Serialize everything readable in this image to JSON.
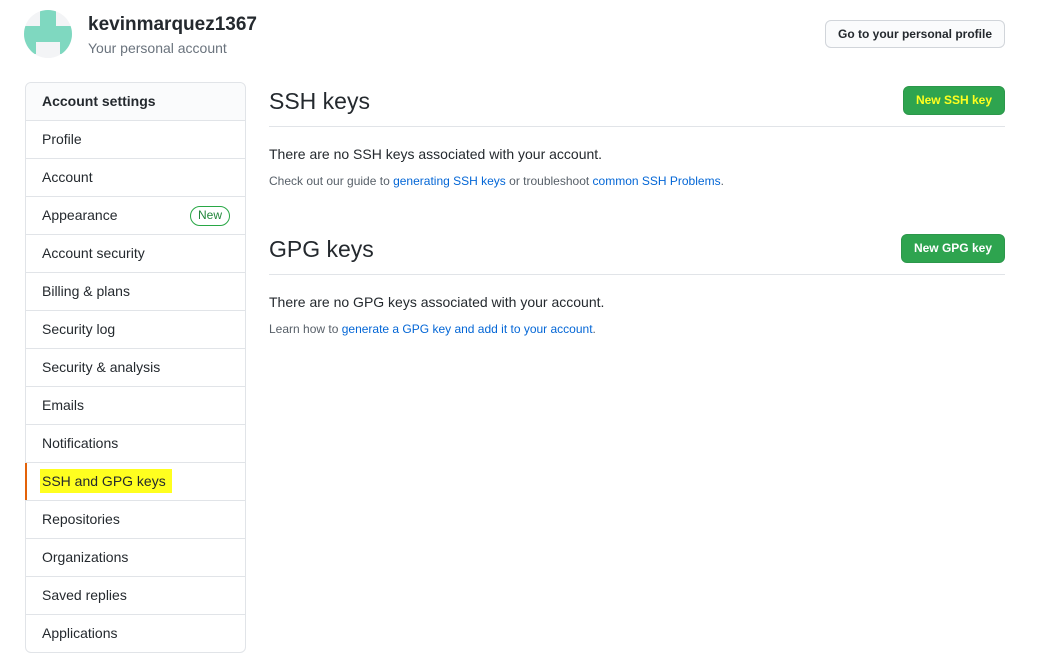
{
  "header": {
    "username": "kevinmarquez1367",
    "subtitle": "Your personal account",
    "profile_button": "Go to your personal profile"
  },
  "sidebar": {
    "heading": "Account settings",
    "items": [
      {
        "label": "Profile"
      },
      {
        "label": "Account"
      },
      {
        "label": "Appearance",
        "badge": "New"
      },
      {
        "label": "Account security"
      },
      {
        "label": "Billing & plans"
      },
      {
        "label": "Security log"
      },
      {
        "label": "Security & analysis"
      },
      {
        "label": "Emails"
      },
      {
        "label": "Notifications"
      },
      {
        "label": "SSH and GPG keys",
        "selected": true
      },
      {
        "label": "Repositories"
      },
      {
        "label": "Organizations"
      },
      {
        "label": "Saved replies"
      },
      {
        "label": "Applications"
      }
    ]
  },
  "ssh": {
    "title": "SSH keys",
    "button": "New SSH key",
    "empty_message": "There are no SSH keys associated with your account.",
    "note_prefix": "Check out our guide to ",
    "link1": "generating SSH keys",
    "note_middle": " or troubleshoot ",
    "link2": "common SSH Problems",
    "note_suffix": "."
  },
  "gpg": {
    "title": "GPG keys",
    "button": "New GPG key",
    "empty_message": "There are no GPG keys associated with your account.",
    "note_prefix": "Learn how to ",
    "link1": "generate a GPG key and add it to your account",
    "note_suffix": "."
  },
  "colors": {
    "primary_button": "#2ea44f",
    "link": "#0366d6",
    "highlight": "#ffff1f",
    "selected_marker": "#e36209"
  },
  "icons": {
    "avatar": "identicon"
  }
}
